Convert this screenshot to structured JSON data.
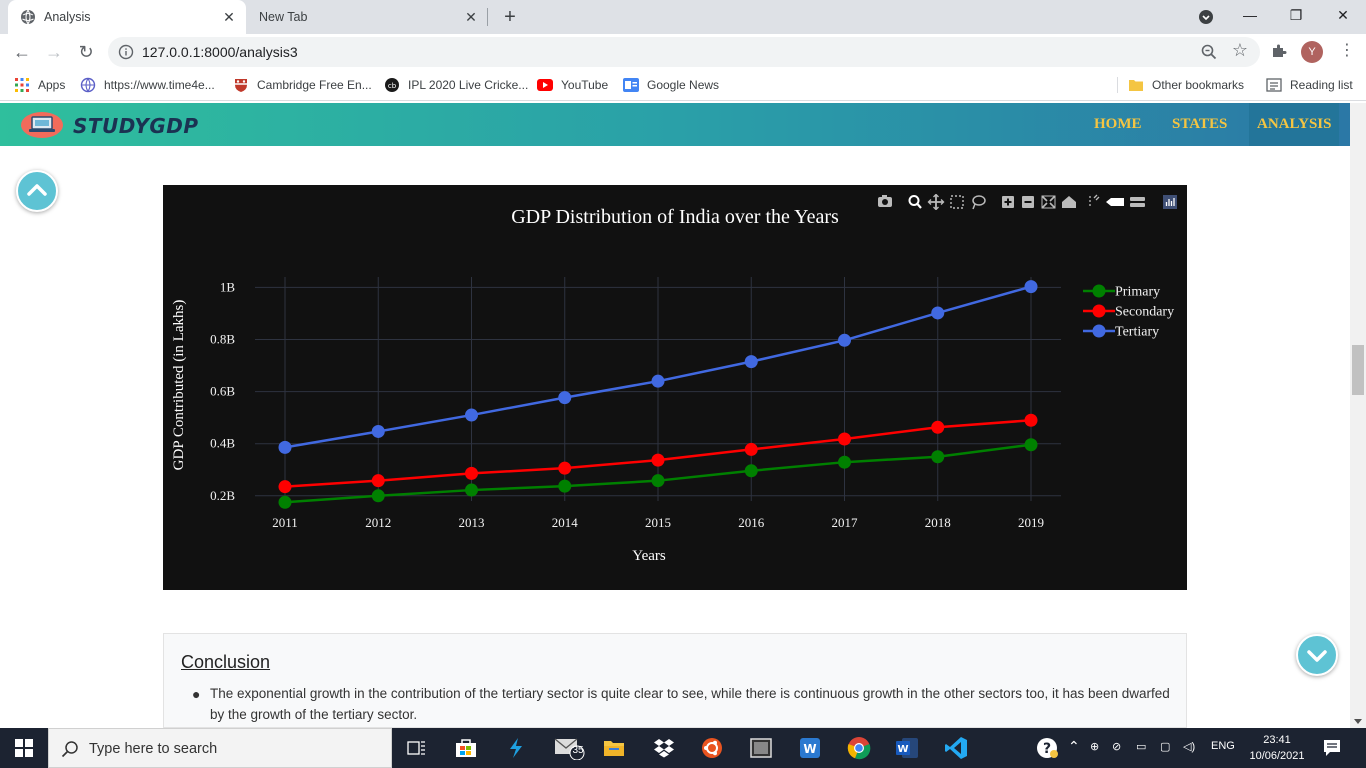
{
  "browser": {
    "tabs": [
      {
        "title": "Analysis",
        "active": true
      },
      {
        "title": "New Tab",
        "active": false
      }
    ],
    "url": "127.0.0.1:8000/analysis3",
    "profile_initial": "Y",
    "bookmarks": [
      {
        "label": "Apps",
        "icon": "apps-grid-icon"
      },
      {
        "label": "https://www.time4e...",
        "icon": "globe-icon"
      },
      {
        "label": "Cambridge Free En...",
        "icon": "cambridge-shield-icon"
      },
      {
        "label": "IPL 2020 Live Cricke...",
        "icon": "cricket-icon"
      },
      {
        "label": "YouTube",
        "icon": "youtube-icon"
      },
      {
        "label": "Google News",
        "icon": "google-news-icon"
      }
    ],
    "other_bookmarks": "Other bookmarks",
    "reading_list": "Reading list"
  },
  "site": {
    "logo": "STUDYGDP",
    "nav": [
      {
        "label": "HOME",
        "active": false
      },
      {
        "label": "STATES",
        "active": false
      },
      {
        "label": "ANALYSIS",
        "active": true
      }
    ],
    "accent_color": "#f5c542"
  },
  "chart_data": {
    "type": "line",
    "title": "GDP Distribution of India over the Years",
    "xlabel": "Years",
    "ylabel": "GDP Contributed (in Lakhs)",
    "x": [
      2011,
      2012,
      2013,
      2014,
      2015,
      2016,
      2017,
      2018,
      2019
    ],
    "ylim": [
      0.18,
      1.04
    ],
    "yticks": [
      0.2,
      0.4,
      0.6,
      0.8,
      1.0
    ],
    "ytick_labels": [
      "0.2B",
      "0.4B",
      "0.6B",
      "0.8B",
      "1B"
    ],
    "series": [
      {
        "name": "Primary",
        "color": "#008000",
        "values": [
          0.175,
          0.2,
          0.222,
          0.237,
          0.258,
          0.296,
          0.329,
          0.35,
          0.396
        ]
      },
      {
        "name": "Secondary",
        "color": "#ff0000",
        "values": [
          0.235,
          0.258,
          0.286,
          0.306,
          0.337,
          0.378,
          0.418,
          0.463,
          0.49
        ]
      },
      {
        "name": "Tertiary",
        "color": "#4169e1",
        "values": [
          0.386,
          0.447,
          0.51,
          0.577,
          0.64,
          0.715,
          0.797,
          0.902,
          1.003
        ]
      }
    ],
    "legend_position": "top-right",
    "background": "#111111",
    "grid": true
  },
  "conclusion": {
    "heading": "Conclusion",
    "points": [
      "The exponential growth in the contribution of the tertiary sector is quite clear to see, while there is continuous growth in the other sectors too, it has been dwarfed by the growth of the tertiary sector."
    ]
  },
  "taskbar": {
    "search_placeholder": "Type here to search",
    "mail_badge": "35",
    "language": "ENG",
    "time": "23:41",
    "date": "10/06/2021"
  }
}
